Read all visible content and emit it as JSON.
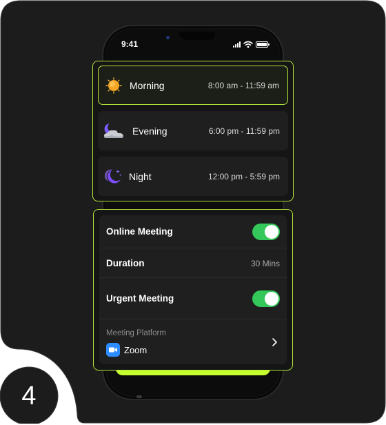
{
  "status_bar": {
    "time": "9:41"
  },
  "time_slots": [
    {
      "name": "Morning",
      "range": "8:00 am - 11:59 am",
      "icon": "sun-icon",
      "selected": true
    },
    {
      "name": "Evening",
      "range": "6:00 pm - 11:59 pm",
      "icon": "moon-cloud-icon",
      "selected": false
    },
    {
      "name": "Night",
      "range": "12:00 pm - 5:59 pm",
      "icon": "moon-stars-icon",
      "selected": false
    }
  ],
  "settings": {
    "online_meeting": {
      "label": "Online Meeting",
      "enabled": true
    },
    "duration": {
      "label": "Duration",
      "value": "30 Mins"
    },
    "urgent_meeting": {
      "label": "Urgent Meeting",
      "enabled": true
    },
    "platform": {
      "caption": "Meeting Platform",
      "value": "Zoom",
      "icon": "zoom-icon"
    }
  },
  "step_badge": {
    "number": "4"
  },
  "colors": {
    "accent": "#c6ff2e",
    "outline": "#b5e63a",
    "toggle_on": "#34c759",
    "zoom_blue": "#2d8cff",
    "card_background": "#1c1c1c"
  }
}
